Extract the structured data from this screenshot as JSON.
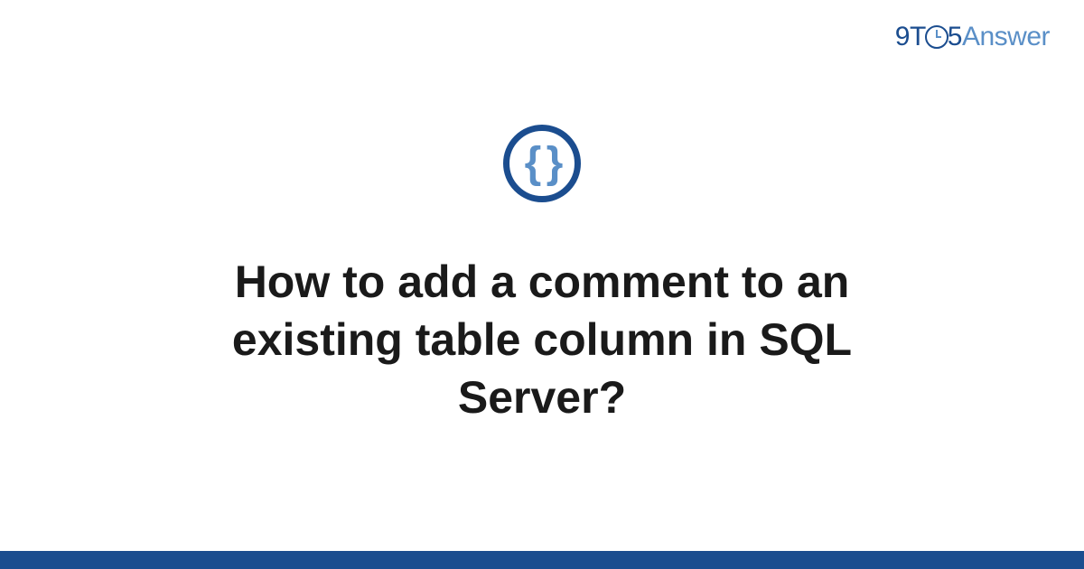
{
  "logo": {
    "nine": "9",
    "t": "T",
    "five": "5",
    "answer": "Answer"
  },
  "icon": {
    "braces": "{ }"
  },
  "title": "How to add a comment to an existing table column in SQL Server?",
  "colors": {
    "primary": "#1b4d8f",
    "accent": "#5a8fc7"
  }
}
